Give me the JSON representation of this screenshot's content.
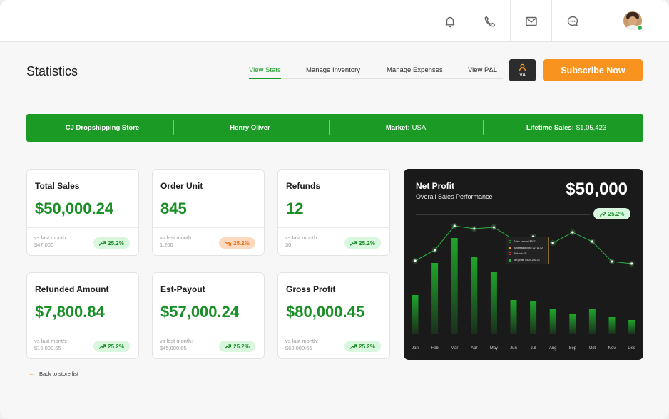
{
  "topbar": {
    "icons": [
      "bell-icon",
      "phone-icon",
      "mail-icon",
      "chat-icon"
    ],
    "user_status_color": "#2bb34a"
  },
  "header": {
    "title": "Statistics",
    "tabs": [
      {
        "label": "View Stats",
        "active": true
      },
      {
        "label": "Manage Inventory",
        "active": false
      },
      {
        "label": "Manage Expenses",
        "active": false
      },
      {
        "label": "View P&L",
        "active": false
      }
    ],
    "user_badge": "VA",
    "subscribe_label": "Subscribe Now"
  },
  "banner": {
    "store": "CJ Dropshipping Store",
    "owner": "Henry Oliver",
    "market_label": "Market:",
    "market_value": "USA",
    "lifetime_label": "Lifetime Sales:",
    "lifetime_value": "$1,05,423"
  },
  "cards": [
    {
      "title": "Total Sales",
      "value": "$50,000.24",
      "compare_label": "vs last month:",
      "compare_value": "$47,000",
      "change": "25.2%",
      "trend": "up"
    },
    {
      "title": "Order Unit",
      "value": "845",
      "compare_label": "vs last month:",
      "compare_value": "1,200",
      "change": "25.2%",
      "trend": "down"
    },
    {
      "title": "Refunds",
      "value": "12",
      "compare_label": "vs last month:",
      "compare_value": "30",
      "change": "25.2%",
      "trend": "up"
    },
    {
      "title": "Refunded Amount",
      "value": "$7,800.84",
      "compare_label": "vs last month:",
      "compare_value": "$15,000.65",
      "change": "25.2%",
      "trend": "up"
    },
    {
      "title": "Est-Payout",
      "value": "$57,000.24",
      "compare_label": "vs last month:",
      "compare_value": "$45,000.65",
      "change": "25.2%",
      "trend": "up"
    },
    {
      "title": "Gross Profit",
      "value": "$80,000.45",
      "compare_label": "vs last month:",
      "compare_value": "$60,000.65",
      "change": "25.2%",
      "trend": "up"
    }
  ],
  "back_link": "Back to store list",
  "net_profit": {
    "title": "Net Profit",
    "subtitle": "Overall Sales Performance",
    "value": "$50,000",
    "change": "25.2%",
    "tooltip": [
      {
        "label": "Sales Amount $3811",
        "color": "#1b9b25"
      },
      {
        "label": "Advertising cost: $2711.42",
        "color": "#f39a21"
      },
      {
        "label": "Refunds: 31",
        "color": "#d23a2a"
      },
      {
        "label": "Net profit: $4,25,000.00",
        "color": "#2bb34a"
      }
    ],
    "chart_data": {
      "type": "bar",
      "categories": [
        "Jan",
        "Feb",
        "Mar",
        "Apr",
        "May",
        "Jun",
        "Jul",
        "Aug",
        "Sep",
        "Oct",
        "Nov",
        "Dec"
      ],
      "series": [
        {
          "values": [
            55,
            100,
            135,
            108,
            87,
            48,
            46,
            35,
            28,
            36,
            24,
            20
          ]
        },
        {
          "values": [
            103,
            118,
            152,
            148,
            150,
            133,
            137,
            128,
            143,
            130,
            102,
            99
          ]
        }
      ],
      "ylim": [
        0,
        170
      ]
    }
  }
}
